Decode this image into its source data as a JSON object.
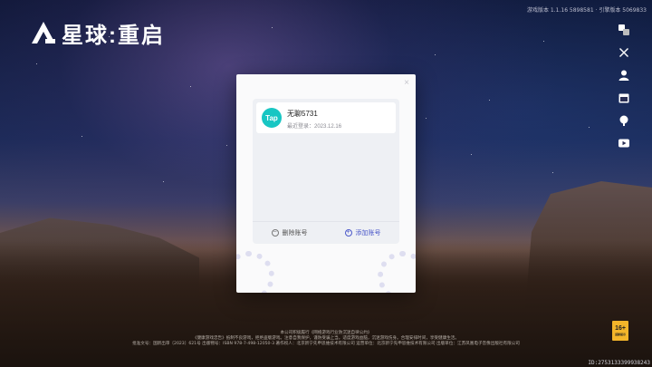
{
  "app": {
    "logo_text": "星球:重启"
  },
  "version_text": "游戏版本 1.1.16 5898581 · 引擎版本 5069833",
  "side_icons": [
    "translate-icon",
    "tools-icon",
    "user-icon",
    "calendar-icon",
    "support-icon",
    "video-icon"
  ],
  "dialog": {
    "account": {
      "name": "无聊5731",
      "last_login": "最近登录：2023.12.16",
      "provider": "Tap"
    },
    "delete_label": "删除账号",
    "add_label": "添加账号",
    "close_glyph": "×"
  },
  "footer": {
    "line1": "本公司积极履行《网络游戏行业防沉迷自律公约》",
    "line2": "《健康游戏忠告》抵制不良游戏，拒绝盗版游戏。注意自我保护，谨防受骗上当。适度游戏益脑，沉迷游戏伤身。合理安排时间，享受健康生活。",
    "line3": "批准文号：国新出审〔2023〕621号 出版物号：ISBN 978-7-498-12050-3 著作权人：北京新宁先申思维技术有限公司 运营单位：北京新宁先申思维技术有限公司 出版单位：江苏凤凰电子音像出版社有限公司"
  },
  "rating": {
    "age": "16+",
    "label": "适龄提示"
  },
  "uid": "ID:2753133399938243",
  "colors": {
    "accent": "#4b58c9",
    "tap": "#18c6c3",
    "rating": "#f3b52a"
  }
}
